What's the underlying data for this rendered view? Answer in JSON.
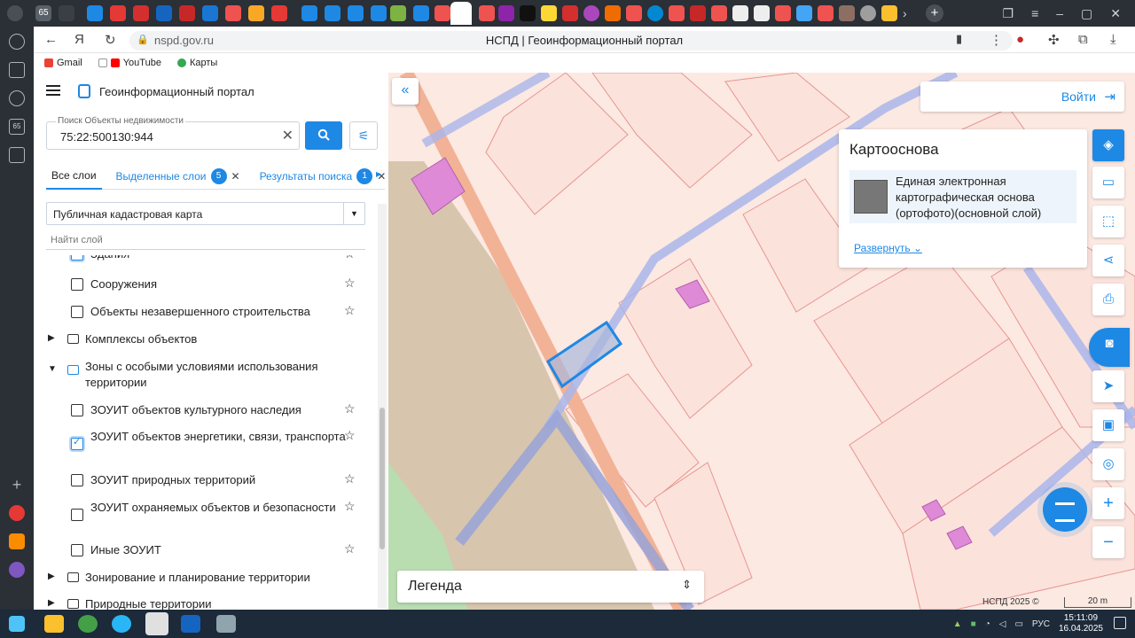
{
  "browser": {
    "url": "nspd.gov.ru",
    "title": "НСПД | Геоинформационный портал",
    "bookmarks": [
      "Gmail",
      "YouTube",
      "Карты"
    ],
    "tab_count_badge": "65",
    "rail_badge": "65"
  },
  "sidebar": {
    "portal_title": "Геоинформационный портал",
    "search": {
      "label": "Поиск Объекты недвижимости",
      "value": "75:22:500130:944"
    },
    "tabs": [
      {
        "label": "Все слои"
      },
      {
        "label": "Выделенные слои",
        "badge": "5"
      },
      {
        "label": "Результаты поиска",
        "badge": "1"
      }
    ],
    "layer_select": "Публичная кадастровая карта",
    "find_layer_placeholder": "Найти слой",
    "layers": {
      "partial_top": "Здания",
      "structures": "Сооружения",
      "unfinished": "Объекты незавершенного строительства",
      "complexes": "Комплексы объектов",
      "zones": "Зоны с особыми условиями использования территории",
      "zouit_heritage": "ЗОУИТ объектов культурного наследия",
      "zouit_energy": "ЗОУИТ объектов энергетики, связи, транспорта",
      "zouit_nature": "ЗОУИТ природных территорий",
      "zouit_protected": "ЗОУИТ охраняемых объектов и безопасности",
      "zouit_other": "Иные ЗОУИТ",
      "zoning": "Зонирование и планирование территории",
      "natural": "Природные территории"
    }
  },
  "map": {
    "login": "Войти",
    "basemap": {
      "title": "Картооснова",
      "item": "Единая электронная картографическая основа (ортофото)(основной слой)",
      "expand": "Развернуть"
    },
    "legend": "Легенда",
    "copyright": "НСПД 2025 ©",
    "scale": "20 m"
  },
  "taskbar": {
    "lang": "РУС",
    "time": "15:11:09",
    "date": "16.04.2025"
  }
}
